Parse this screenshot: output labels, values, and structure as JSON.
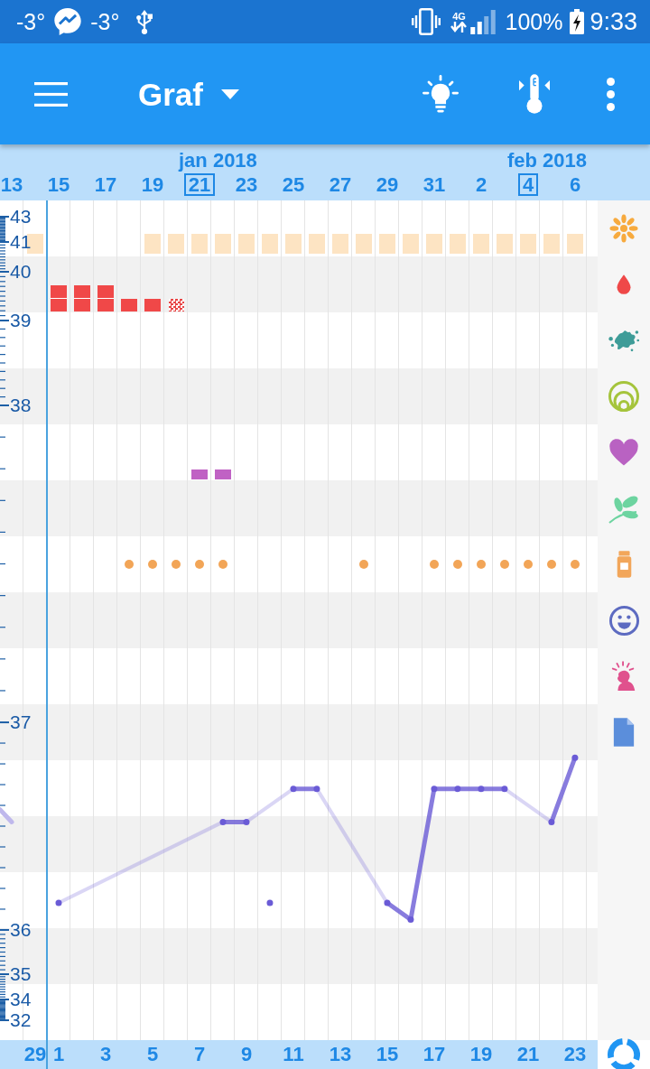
{
  "status_bar": {
    "left_texts": [
      "-3°",
      "-3°"
    ],
    "network_type": "4G",
    "battery": "100%",
    "time": "9:33"
  },
  "app_bar": {
    "title": "Graf"
  },
  "header": {
    "days": [
      {
        "label": "13",
        "boxed": false
      },
      {
        "label": "15",
        "boxed": false
      },
      {
        "label": "17",
        "boxed": false
      },
      {
        "label": "19",
        "boxed": false
      },
      {
        "label": "21",
        "boxed": true,
        "month": "jan 2018"
      },
      {
        "label": "23",
        "boxed": false
      },
      {
        "label": "25",
        "boxed": false
      },
      {
        "label": "27",
        "boxed": false
      },
      {
        "label": "29",
        "boxed": false
      },
      {
        "label": "31",
        "boxed": false
      },
      {
        "label": "2",
        "boxed": false
      },
      {
        "label": "4",
        "boxed": true,
        "month": "feb 2018"
      },
      {
        "label": "6",
        "boxed": false
      }
    ]
  },
  "symbol_rows": [
    {
      "kind": "flower",
      "marks": [
        {
          "kind": "none"
        },
        {
          "kind": "block"
        },
        {
          "kind": "none"
        },
        {
          "kind": "none"
        },
        {
          "kind": "none"
        },
        {
          "kind": "none"
        },
        {
          "kind": "block"
        },
        {
          "kind": "block"
        },
        {
          "kind": "block"
        },
        {
          "kind": "block"
        },
        {
          "kind": "block"
        },
        {
          "kind": "block"
        },
        {
          "kind": "block"
        },
        {
          "kind": "block"
        },
        {
          "kind": "block"
        },
        {
          "kind": "block"
        },
        {
          "kind": "block"
        },
        {
          "kind": "block"
        },
        {
          "kind": "block"
        },
        {
          "kind": "block"
        },
        {
          "kind": "block"
        },
        {
          "kind": "block"
        },
        {
          "kind": "block"
        },
        {
          "kind": "block"
        },
        {
          "kind": "block"
        }
      ]
    },
    {
      "kind": "drop",
      "marks": [
        {
          "kind": "none"
        },
        {
          "kind": "none"
        },
        {
          "kind": "heavy"
        },
        {
          "kind": "heavy"
        },
        {
          "kind": "heavy"
        },
        {
          "kind": "light"
        },
        {
          "kind": "light"
        },
        {
          "kind": "spotting"
        },
        {
          "kind": "none"
        },
        {
          "kind": "none"
        },
        {
          "kind": "none"
        },
        {
          "kind": "none"
        },
        {
          "kind": "none"
        },
        {
          "kind": "none"
        },
        {
          "kind": "none"
        },
        {
          "kind": "none"
        },
        {
          "kind": "none"
        },
        {
          "kind": "none"
        },
        {
          "kind": "none"
        },
        {
          "kind": "none"
        },
        {
          "kind": "none"
        },
        {
          "kind": "none"
        },
        {
          "kind": "none"
        },
        {
          "kind": "none"
        },
        {
          "kind": "none"
        }
      ]
    },
    {
      "kind": "splash"
    },
    {
      "kind": "rings"
    },
    {
      "kind": "heart",
      "marks": [
        {
          "kind": "none"
        },
        {
          "kind": "none"
        },
        {
          "kind": "none"
        },
        {
          "kind": "none"
        },
        {
          "kind": "none"
        },
        {
          "kind": "none"
        },
        {
          "kind": "none"
        },
        {
          "kind": "none"
        },
        {
          "kind": "bar"
        },
        {
          "kind": "bar"
        },
        {
          "kind": "none"
        },
        {
          "kind": "none"
        },
        {
          "kind": "none"
        },
        {
          "kind": "none"
        },
        {
          "kind": "none"
        },
        {
          "kind": "none"
        },
        {
          "kind": "none"
        },
        {
          "kind": "none"
        },
        {
          "kind": "none"
        },
        {
          "kind": "none"
        },
        {
          "kind": "none"
        },
        {
          "kind": "none"
        },
        {
          "kind": "none"
        },
        {
          "kind": "none"
        },
        {
          "kind": "none"
        }
      ]
    },
    {
      "kind": "leaf"
    },
    {
      "kind": "bottle",
      "marks": [
        {
          "kind": "none"
        },
        {
          "kind": "none"
        },
        {
          "kind": "none"
        },
        {
          "kind": "none"
        },
        {
          "kind": "none"
        },
        {
          "kind": "dot"
        },
        {
          "kind": "dot"
        },
        {
          "kind": "dot"
        },
        {
          "kind": "dot"
        },
        {
          "kind": "dot"
        },
        {
          "kind": "none"
        },
        {
          "kind": "none"
        },
        {
          "kind": "none"
        },
        {
          "kind": "none"
        },
        {
          "kind": "none"
        },
        {
          "kind": "dot"
        },
        {
          "kind": "none"
        },
        {
          "kind": "none"
        },
        {
          "kind": "dot"
        },
        {
          "kind": "dot"
        },
        {
          "kind": "dot"
        },
        {
          "kind": "dot"
        },
        {
          "kind": "dot"
        },
        {
          "kind": "dot"
        },
        {
          "kind": "dot"
        }
      ]
    },
    {
      "kind": "smiley"
    },
    {
      "kind": "figure"
    },
    {
      "kind": "page"
    }
  ],
  "chart": {
    "upper_scale_labels": [
      "43",
      "41",
      "40",
      "39",
      "38"
    ],
    "lower_scale_labels": [
      "35",
      "34",
      "32"
    ],
    "previous_cycle_day_label": "29",
    "chart_data": {
      "type": "line",
      "x": [
        -1.5,
        -1,
        1,
        8,
        9,
        10,
        11,
        12,
        15,
        16,
        17,
        18,
        19,
        20,
        22,
        23
      ],
      "xlim": [
        -1.5,
        23.85
      ],
      "xticks": [
        1,
        3,
        5,
        7,
        9,
        11,
        13,
        15,
        17,
        19,
        21,
        23
      ],
      "ylim": [
        35.33,
        40.48
      ],
      "yticks": [
        37,
        36
      ],
      "series": [
        {
          "color": "#bfb8ec",
          "values": [
            36.58,
            36.52,
            null,
            null,
            null,
            null,
            null,
            null,
            null,
            null,
            null,
            null,
            null,
            null,
            null,
            null
          ]
        },
        {
          "color": "#6a5bd6",
          "marker": "o",
          "values": [
            null,
            null,
            36.13,
            36.52,
            36.52,
            null,
            36.68,
            36.68,
            36.13,
            36.05,
            36.68,
            36.68,
            36.68,
            36.68,
            36.52,
            36.83
          ]
        },
        {
          "color": "#6a5bd6",
          "marker": "o",
          "values": [
            null,
            null,
            null,
            null,
            null,
            36.13,
            null,
            null,
            null,
            null,
            null,
            null,
            null,
            null,
            null,
            null
          ]
        }
      ],
      "ref_lines": [
        {
          "axis": "x",
          "value": 0.5
        }
      ]
    }
  }
}
